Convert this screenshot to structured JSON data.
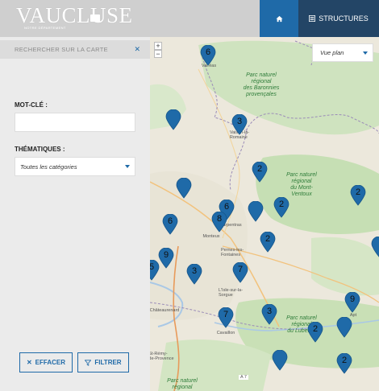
{
  "header": {
    "logo_text": "VAUCLUSE",
    "logo_sub": "NOTRE DÉPARTEMENT",
    "home_icon": "home-icon",
    "structures_label": "STRUCTURES",
    "structures_icon": "list-icon",
    "colors": {
      "home_bg": "#1f6aa8",
      "structures_bg": "#234566",
      "header_bg": "#cfcfcf"
    }
  },
  "sidebar": {
    "search_label": "RECHERCHER SUR LA CARTE",
    "close_icon": "close-icon",
    "keyword_label": "MOT-CLÉ :",
    "keyword_value": "",
    "themes_label": "THÉMATIQUES :",
    "themes_selected": "Toutes les catégories",
    "clear_label": "EFFACER",
    "filter_label": "FILTRER"
  },
  "map": {
    "view_label": "Vue plan",
    "zoom_in": "+",
    "zoom_out": "−",
    "park_labels": [
      {
        "text": "Parc naturel\nrégional\ndes Baronnies\nprovençales"
      },
      {
        "text": "Parc naturel\nrégional\ndu Mont-\nVentoux"
      },
      {
        "text": "Parc naturel\nrégional\ndu Luberon"
      },
      {
        "text": "Parc naturel\nrégional\ndes Alpilles"
      }
    ],
    "towns": [
      "Valréas",
      "Vaison-la-\nRomaine",
      "Carpentras",
      "Monteux",
      "Pernes-les-\nFontaines",
      "L'Isle-sur-la-\nSorgue",
      "Cavaillon",
      "Apt",
      "St-Rémy-\nde-Provence",
      "Châteaurenard",
      "A 7"
    ],
    "markers": [
      {
        "count": "6"
      },
      {
        "count": ""
      },
      {
        "count": "3"
      },
      {
        "count": "2"
      },
      {
        "count": ""
      },
      {
        "count": "6"
      },
      {
        "count": "8"
      },
      {
        "count": ""
      },
      {
        "count": "2"
      },
      {
        "count": "2"
      },
      {
        "count": "6"
      },
      {
        "count": "2"
      },
      {
        "count": "9"
      },
      {
        "count": "5"
      },
      {
        "count": "3"
      },
      {
        "count": "7"
      },
      {
        "count": ""
      },
      {
        "count": "7"
      },
      {
        "count": "3"
      },
      {
        "count": "2"
      },
      {
        "count": ""
      },
      {
        "count": "9"
      },
      {
        "count": ""
      },
      {
        "count": "2"
      }
    ],
    "marker_color": "#1f6aa8"
  }
}
